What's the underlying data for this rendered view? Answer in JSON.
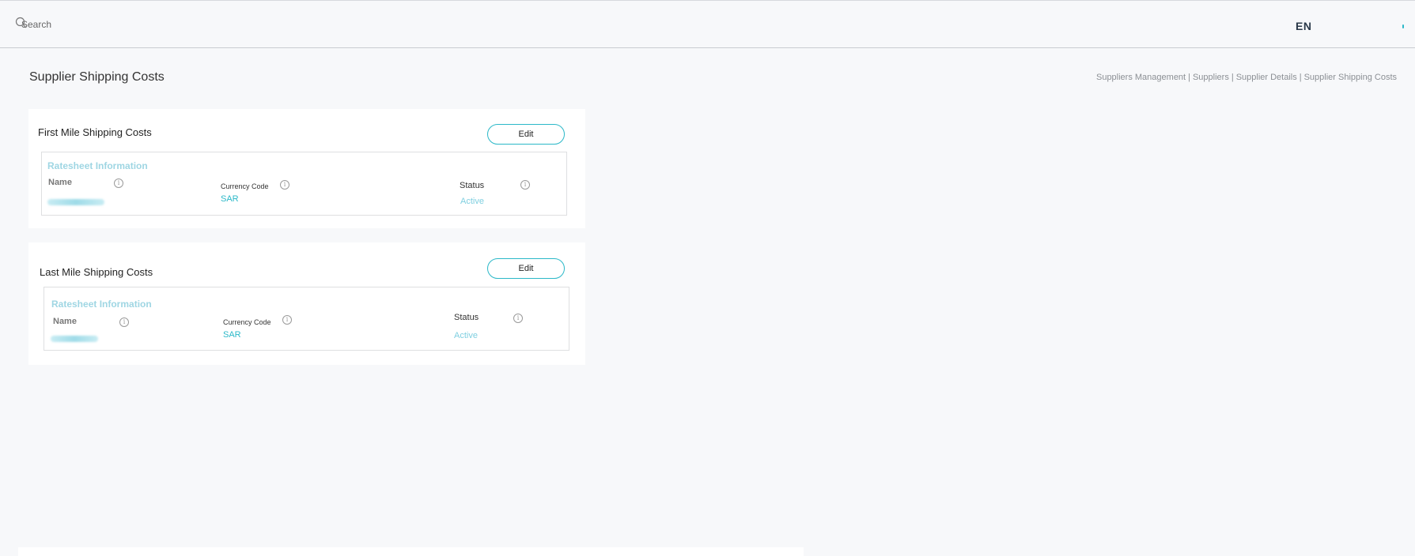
{
  "header": {
    "search_placeholder": "Search",
    "language": "EN"
  },
  "page": {
    "title": "Supplier Shipping Costs",
    "breadcrumb": [
      "Suppliers Management",
      "Suppliers",
      "Supplier Details",
      "Supplier Shipping Costs"
    ]
  },
  "sections": [
    {
      "title": "First Mile Shipping Costs",
      "edit_label": "Edit",
      "ratesheet": {
        "title": "Ratesheet Information",
        "name_label": "Name",
        "currency_label": "Currency Code",
        "currency_value": "SAR",
        "status_label": "Status",
        "status_value": "Active"
      }
    },
    {
      "title": "Last Mile Shipping Costs",
      "edit_label": "Edit",
      "ratesheet": {
        "title": "Ratesheet Information",
        "name_label": "Name",
        "currency_label": "Currency Code",
        "currency_value": "SAR",
        "status_label": "Status",
        "status_value": "Active"
      }
    }
  ],
  "colors": {
    "accent": "#2bb8c8",
    "accent_light": "#9fd6e3",
    "background": "#f7f8fa"
  },
  "icons": {
    "search": "search-icon",
    "info": "info-icon"
  }
}
